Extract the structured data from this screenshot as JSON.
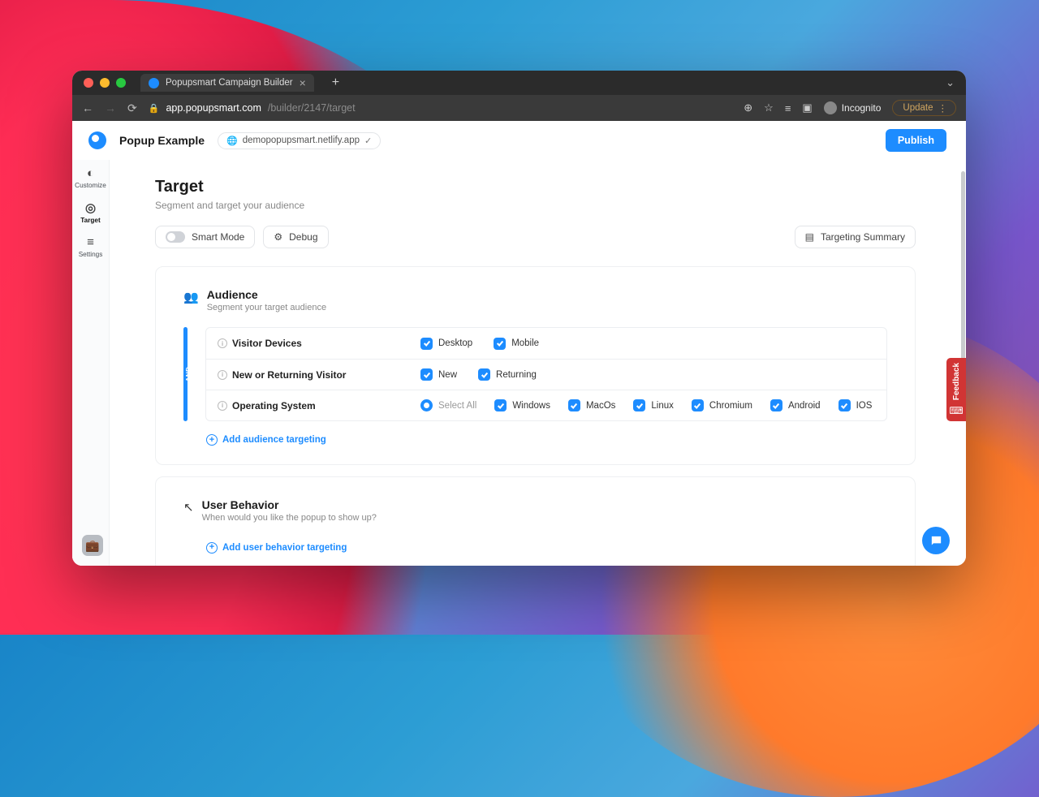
{
  "browser": {
    "tab_title": "Popupsmart Campaign Builder",
    "url_domain": "app.popupsmart.com",
    "url_path": "/builder/2147/target",
    "incognito_label": "Incognito",
    "update_label": "Update"
  },
  "header": {
    "app_name": "Popup Example",
    "host": "demopopupsmart.netlify.app",
    "publish_label": "Publish"
  },
  "sidebar": {
    "items": [
      {
        "label": "Customize",
        "active": false
      },
      {
        "label": "Target",
        "active": true
      },
      {
        "label": "Settings",
        "active": false
      }
    ]
  },
  "page": {
    "title": "Target",
    "subtitle": "Segment and target your audience"
  },
  "toolbar": {
    "smart_mode_label": "Smart Mode",
    "debug_label": "Debug",
    "summary_label": "Targeting Summary"
  },
  "audience": {
    "title": "Audience",
    "subtitle": "Segment your target audience",
    "and_label": "AND",
    "rows": [
      {
        "name": "Visitor Devices",
        "options": [
          {
            "label": "Desktop",
            "checked": true
          },
          {
            "label": "Mobile",
            "checked": true
          }
        ]
      },
      {
        "name": "New or Returning Visitor",
        "options": [
          {
            "label": "New",
            "checked": true
          },
          {
            "label": "Returning",
            "checked": true
          }
        ]
      },
      {
        "name": "Operating System",
        "select_all_label": "Select All",
        "options": [
          {
            "label": "Windows",
            "checked": true
          },
          {
            "label": "MacOs",
            "checked": true
          },
          {
            "label": "Linux",
            "checked": true
          },
          {
            "label": "Chromium",
            "checked": true
          },
          {
            "label": "Android",
            "checked": true
          },
          {
            "label": "IOS",
            "checked": true
          }
        ]
      }
    ],
    "add_label": "Add audience targeting"
  },
  "behavior": {
    "title": "User Behavior",
    "subtitle": "When would you like the popup to show up?",
    "add_label": "Add user behavior targeting"
  },
  "feedback_label": "Feedback"
}
